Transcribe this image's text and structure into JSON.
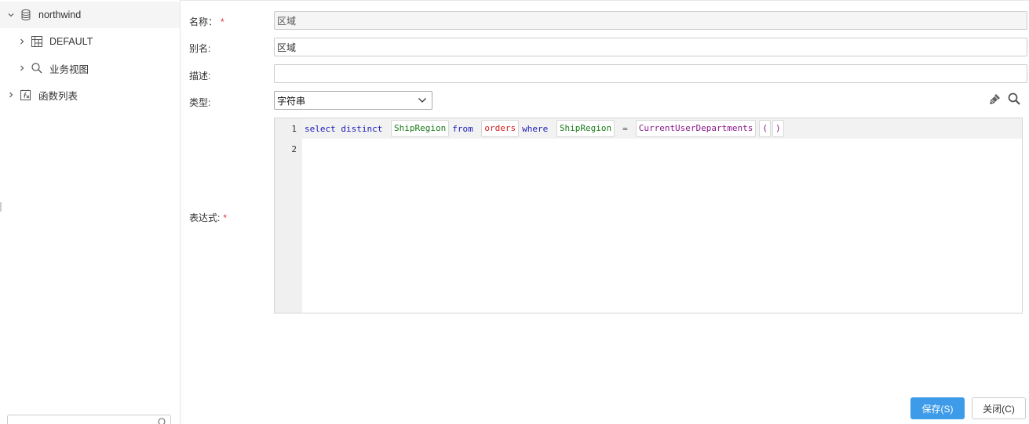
{
  "sidebar": {
    "tree": [
      {
        "label": "northwind",
        "icon": "database-icon",
        "expanded": true
      },
      {
        "label": "DEFAULT",
        "icon": "table-grid-icon",
        "expanded": false
      },
      {
        "label": "业务视图",
        "icon": "search-icon",
        "expanded": false
      },
      {
        "label": "函数列表",
        "icon": "function-list-icon",
        "expanded": false
      }
    ],
    "search_placeholder": ""
  },
  "form": {
    "name_label": "名称：",
    "name_value": "区域",
    "alias_label": "别名:",
    "alias_value": "区域",
    "desc_label": "描述:",
    "desc_value": "",
    "type_label": "类型:",
    "type_value": "字符串",
    "expr_label": "表达式:",
    "required_mark": "*"
  },
  "editor": {
    "line_numbers": [
      "1",
      "2"
    ],
    "tokens": {
      "select": "select",
      "distinct": "distinct",
      "field1": "ShipRegion",
      "from": "from",
      "table": "orders",
      "where": "where",
      "field2": "ShipRegion",
      "op": "=",
      "func": "CurrentUserDepartments",
      "lparen": "(",
      "rparen": ")"
    }
  },
  "buttons": {
    "save": "保存(S)",
    "close": "关闭(C)"
  },
  "colors": {
    "primary": "#3d9be9",
    "required": "#e0373a",
    "keyword": "#1a1ab8",
    "field": "#1a7a1a",
    "table": "#d42020",
    "function": "#8b1a8b"
  }
}
